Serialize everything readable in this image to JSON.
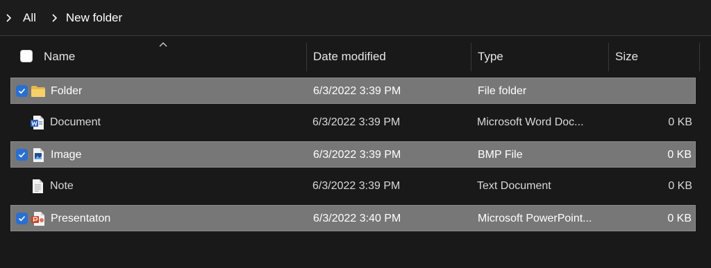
{
  "breadcrumb": {
    "items": [
      "All",
      "New folder"
    ]
  },
  "columns": {
    "name": "Name",
    "date": "Date modified",
    "type": "Type",
    "size": "Size"
  },
  "rows": [
    {
      "name": "Folder",
      "date": "6/3/2022 3:39 PM",
      "type": "File folder",
      "size": "",
      "selected": true,
      "icon": "folder-icon"
    },
    {
      "name": "Document",
      "date": "6/3/2022 3:39 PM",
      "type": "Microsoft Word Doc...",
      "size": "0 KB",
      "selected": false,
      "icon": "word-document-icon"
    },
    {
      "name": "Image",
      "date": "6/3/2022 3:39 PM",
      "type": "BMP File",
      "size": "0 KB",
      "selected": true,
      "icon": "bmp-image-icon"
    },
    {
      "name": "Note",
      "date": "6/3/2022 3:39 PM",
      "type": "Text Document",
      "size": "0 KB",
      "selected": false,
      "icon": "text-document-icon"
    },
    {
      "name": "Presentaton",
      "date": "6/3/2022 3:40 PM",
      "type": "Microsoft PowerPoint...",
      "size": "0 KB",
      "selected": true,
      "icon": "powerpoint-icon"
    }
  ],
  "colors": {
    "background": "#191919",
    "selection": "#777777",
    "checkbox_accent": "#2a6fd0"
  }
}
